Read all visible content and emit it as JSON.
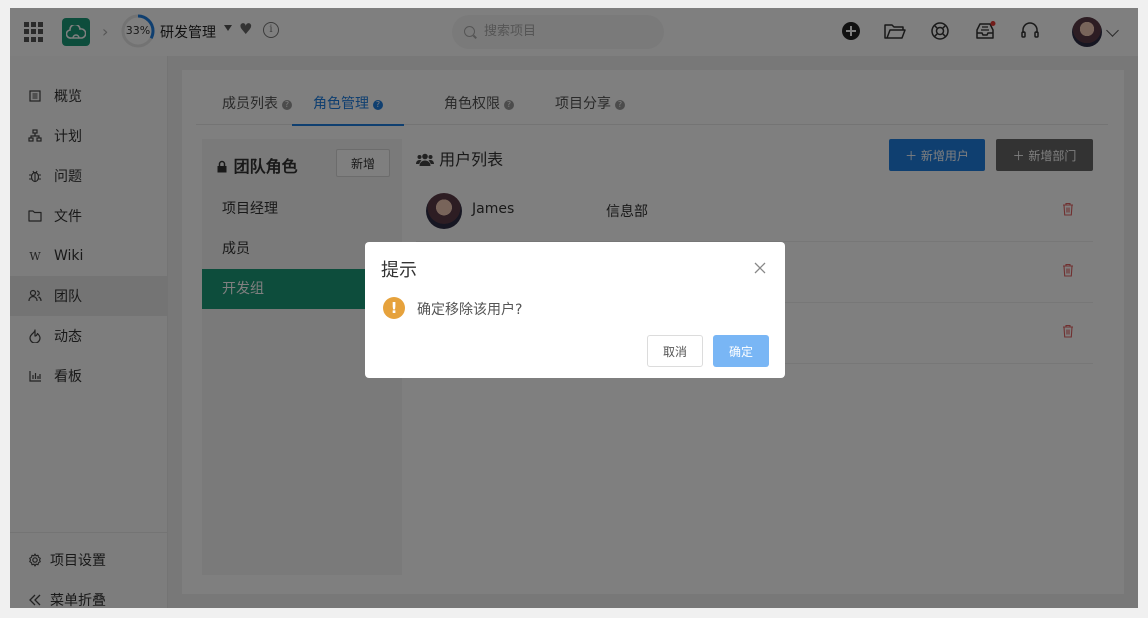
{
  "topbar": {
    "progress": "33%",
    "progress_value": 0.33,
    "project_name": "研发管理",
    "search_placeholder": "搜索项目",
    "notification_dot_color": "#e53935"
  },
  "sidebar": {
    "items": [
      {
        "label": "概览",
        "icon": "overview-icon"
      },
      {
        "label": "计划",
        "icon": "plan-icon"
      },
      {
        "label": "问题",
        "icon": "bug-icon"
      },
      {
        "label": "文件",
        "icon": "folder-icon"
      },
      {
        "label": "Wiki",
        "icon": "wiki-icon"
      },
      {
        "label": "团队",
        "icon": "team-icon"
      },
      {
        "label": "动态",
        "icon": "activity-icon"
      },
      {
        "label": "看板",
        "icon": "board-icon"
      }
    ],
    "active": "团队",
    "settings_label": "项目设置",
    "collapse_label": "菜单折叠"
  },
  "tabs": [
    {
      "label": "成员列表"
    },
    {
      "label": "角色管理"
    },
    {
      "label": "角色权限"
    },
    {
      "label": "项目分享"
    }
  ],
  "roles": {
    "title": "团队角色",
    "add_label": "新增",
    "items": [
      "项目经理",
      "成员",
      "开发组"
    ],
    "active": "开发组"
  },
  "users": {
    "title": "用户列表",
    "add_user_label": "新增用户",
    "add_dept_label": "新增部门",
    "rows": [
      {
        "name": "James",
        "dept": "信息部"
      }
    ]
  },
  "dialog": {
    "title": "提示",
    "message": "确定移除该用户?",
    "cancel_label": "取消",
    "ok_label": "确定"
  },
  "colors": {
    "accent": "#1f7ee0",
    "brand_green": "#1a9a78",
    "warning": "#e6a23c",
    "danger": "#e06060"
  }
}
